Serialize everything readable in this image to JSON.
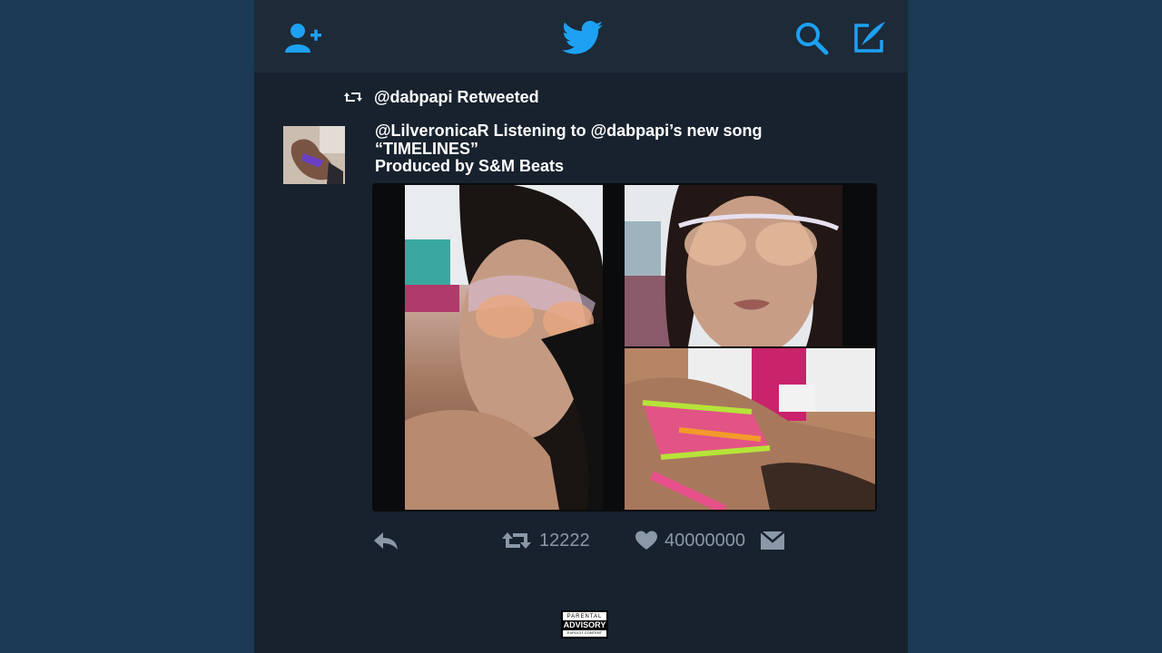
{
  "colors": {
    "page_bg": "#1a3a55",
    "panel_bg": "#17222e",
    "topbar_bg": "#1d2a38",
    "accent": "#1da1f2",
    "muted": "#8b98a8"
  },
  "topbar": {
    "icons": [
      "add-user-icon",
      "twitter-bird-icon",
      "search-icon",
      "compose-icon"
    ]
  },
  "tweet": {
    "retweeted_by": "@dabpapi Retweeted",
    "line1": "@LilveronicaR Listening to @dabpapi’s new song",
    "line2": "“TIMELINES”",
    "line3": "Produced by S&M Beats",
    "retweets": "12222",
    "likes": "40000000"
  },
  "advisory": {
    "line1": "PARENTAL",
    "line2": "ADVISORY",
    "line3": "EXPLICIT CONTENT"
  }
}
